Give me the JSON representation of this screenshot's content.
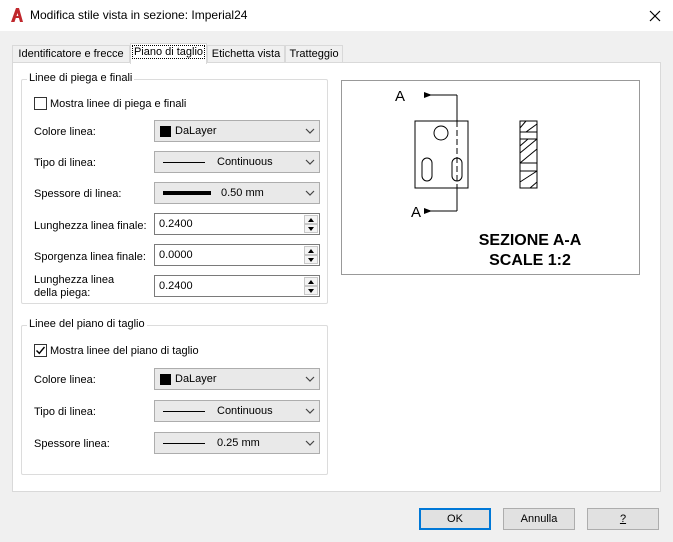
{
  "window": {
    "title": "Modifica stile vista in sezione: Imperial24",
    "accent_color": "#c0282d"
  },
  "tabs": [
    {
      "label": "Identificatore e frecce"
    },
    {
      "label": "Piano di taglio",
      "active": true
    },
    {
      "label": "Etichetta vista"
    },
    {
      "label": "Tratteggio"
    }
  ],
  "bend_group": {
    "title": "Linee di piega e finali",
    "show_checkbox": {
      "label": "Mostra linee di piega e finali",
      "checked": false
    },
    "line_color": {
      "label": "Colore linea:",
      "value": "DaLayer"
    },
    "line_type": {
      "label": "Tipo di linea:",
      "value": "Continuous"
    },
    "line_weight": {
      "label": "Spessore di linea:",
      "value": "0.50 mm"
    },
    "end_length": {
      "label": "Lunghezza linea finale:",
      "value": "0.2400"
    },
    "end_overhang": {
      "label": "Sporgenza linea finale:",
      "value": "0.0000"
    },
    "bend_length": {
      "label_line1": "Lunghezza linea",
      "label_line2": "della piega:",
      "value": "0.2400"
    }
  },
  "plane_group": {
    "title": "Linee del piano di taglio",
    "show_checkbox": {
      "label": "Mostra linee del piano di taglio",
      "checked": true
    },
    "line_color": {
      "label": "Colore linea:",
      "value": "DaLayer"
    },
    "line_type": {
      "label": "Tipo di linea:",
      "value": "Continuous"
    },
    "line_weight": {
      "label": "Spessore linea:",
      "value": "0.25 mm"
    }
  },
  "preview": {
    "arrow_label_top": "A",
    "arrow_label_bottom": "A",
    "caption_line1": "SEZIONE A-A",
    "caption_line2": "SCALE 1:2"
  },
  "footer": {
    "ok_label": "OK",
    "cancel_label": "Annulla",
    "help_label": "?"
  }
}
